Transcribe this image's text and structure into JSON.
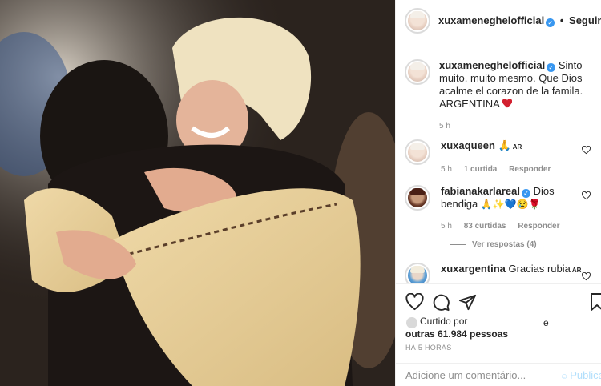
{
  "post": {
    "username": "xuxameneghelofficial",
    "separator": "•",
    "follow_label": "Seguindo"
  },
  "caption": {
    "username": "xuxameneghelofficial",
    "text": "Sinto muito, muito mesmo. Que Dios acalme el corazon de la famila. ARGENTINA",
    "time": "5 h"
  },
  "comments": [
    {
      "username": "xuxaqueen",
      "text": "🙏",
      "flag": "AR",
      "time": "5 h",
      "likes": "1 curtida",
      "reply": "Responder"
    },
    {
      "username": "fabianakarlareal",
      "text": "Dios bendiga",
      "emojis": "🙏✨💙😢🌹",
      "time": "5 h",
      "likes": "83 curtidas",
      "reply": "Responder",
      "view_replies": "Ver respostas (4)"
    },
    {
      "username": "xuxargentina",
      "text": "Gracias rubia",
      "flag": "AR"
    }
  ],
  "likes": {
    "prefix": "Curtido por",
    "suffix": "e",
    "others": "outras 61.984 pessoas"
  },
  "timestamp": "HÁ 5 HORAS",
  "add_comment": {
    "placeholder": "Adicione um comentário...",
    "publish": "Publica"
  },
  "colors": {
    "verified": "#3897f0",
    "heart": "#ed4956",
    "muted": "#8e8e8e",
    "publish": "#b2dffc"
  },
  "icons": [
    "heart-icon",
    "comment-icon",
    "share-icon",
    "bookmark-icon",
    "verified-badge-icon",
    "emoji-icon"
  ]
}
